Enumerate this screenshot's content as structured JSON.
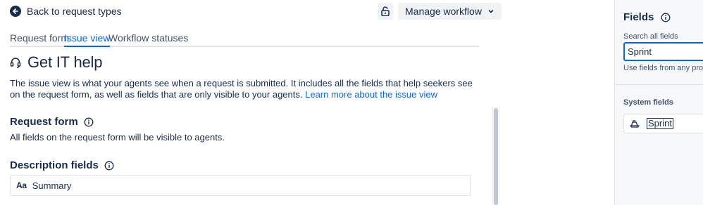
{
  "header": {
    "back_label": "Back to request types",
    "manage_workflow_label": "Manage workflow"
  },
  "tabs": [
    {
      "label": "Request form",
      "active": false
    },
    {
      "label": "Issue view",
      "active": true
    },
    {
      "label": "Workflow statuses",
      "active": false
    }
  ],
  "page": {
    "title": "Get IT help",
    "description": "The issue view is what your agents see when a request is submitted. It includes all the fields that help seekers see on the request form, as well as fields that are only visible to your agents. ",
    "learn_more_link": "Learn more about the issue view"
  },
  "request_form": {
    "heading": "Request form",
    "text": "All fields on the request form will be visible to agents."
  },
  "description_fields": {
    "heading": "Description fields",
    "fields": [
      {
        "type_icon": "Aa",
        "label": "Summary"
      }
    ]
  },
  "fields_panel": {
    "title": "Fields",
    "search_label": "Search all fields",
    "search_value": "Sprint",
    "search_help": "Use fields from any project",
    "system_fields_label": "System fields",
    "system_fields": [
      {
        "icon": "sprint-icon",
        "label": "Sprint"
      }
    ]
  },
  "colors": {
    "accent": "#0c66e4",
    "text": "#172b4d",
    "subtle_bg": "#f1f2f4",
    "panel_bg": "#f7f8f9"
  }
}
